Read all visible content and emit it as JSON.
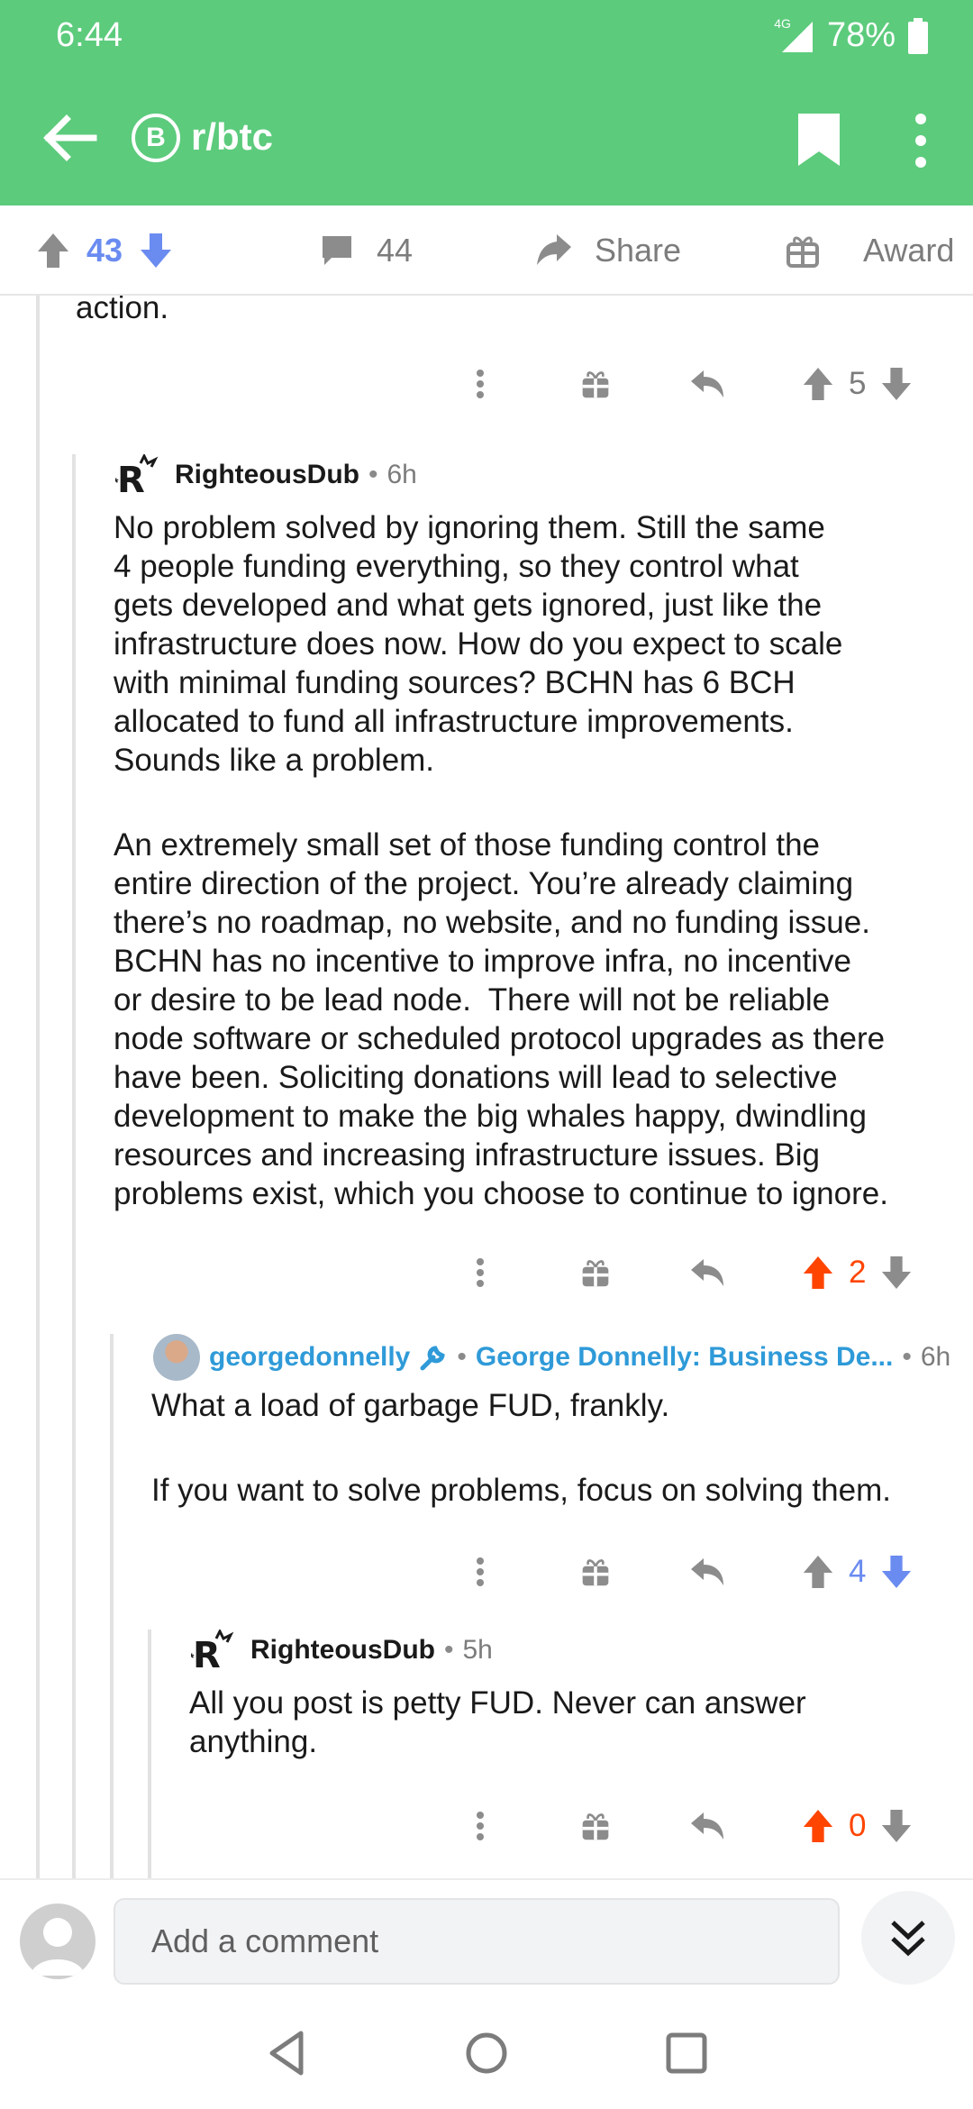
{
  "status_bar": {
    "time": "6:44",
    "network": "4G",
    "battery": "78%"
  },
  "app_bar": {
    "subreddit": "r/btc",
    "subreddit_icon_glyph": "B",
    "icons": [
      "back-arrow-icon",
      "bookmark-icon",
      "more-vertical-icon"
    ]
  },
  "post_actions": {
    "votes": "43",
    "comments": "44",
    "share_label": "Share",
    "award_label": "Award"
  },
  "colors": {
    "accent": "#5ccb7c",
    "upvote_active": "#ff4500",
    "downvote_active": "#6a8bf0",
    "link_blue": "#2f9ad8"
  },
  "thread": {
    "prev_tail": "action.",
    "prev_actions": {
      "score": "5"
    },
    "comments": [
      {
        "author": "RighteousDub",
        "age": "6h",
        "paragraphs": [
          "No problem solved by ignoring them. Still the same\n4 people funding everything, so they control what\ngets developed and what gets ignored, just like the\ninfrastructure does now. How do you expect to scale\nwith minimal funding sources? BCHN has 6 BCH\nallocated to fund all infrastructure improvements.\nSounds like a problem.",
          "An extremely small set of those funding control the\nentire direction of the project. You’re already claiming\nthere’s no roadmap, no website, and no funding issue.\nBCHN has no incentive to improve infra, no incentive\nor desire to be lead node.  There will not be reliable\nnode software or scheduled protocol upgrades as there\nhave been. Soliciting donations will lead to selective\ndevelopment to make the big whales happy, dwindling\nresources and increasing infrastructure issues. Big\nproblems exist, which you choose to continue to ignore."
        ],
        "score": "2",
        "vote_state": "up"
      },
      {
        "author": "georgedonnelly",
        "flair": "George Donnelly: Business De...",
        "age": "6h",
        "paragraphs": [
          "What a load of garbage FUD, frankly.",
          "If you want to solve problems, focus on solving them."
        ],
        "score": "4",
        "vote_state": "down"
      },
      {
        "author": "RighteousDub",
        "age": "5h",
        "paragraphs": [
          "All you post is petty FUD. Never can answer\nanything."
        ],
        "score": "0",
        "vote_state": "up"
      }
    ]
  },
  "comment_bar": {
    "placeholder": "Add a comment"
  }
}
